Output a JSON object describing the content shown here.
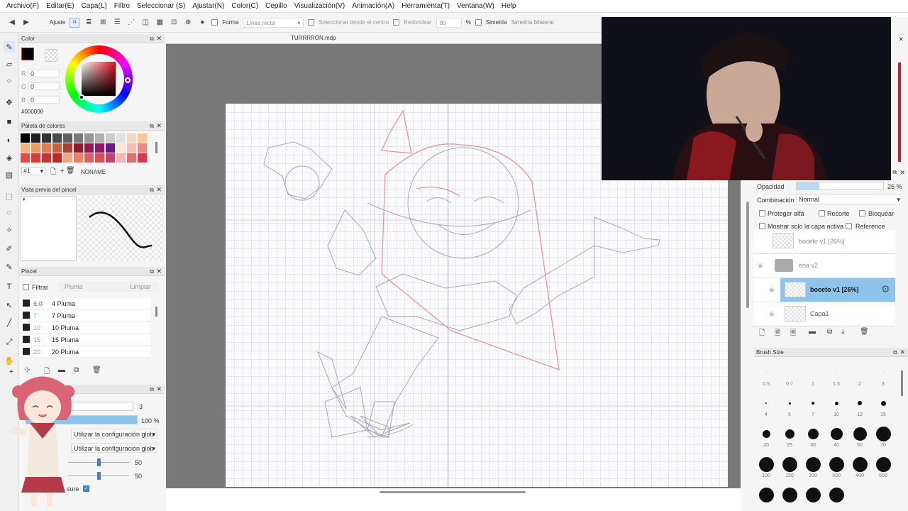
{
  "menu": [
    "Archivo(F)",
    "Editar(E)",
    "Capa(L)",
    "Filtro",
    "Seleccionar (S)",
    "Ajustar(N)",
    "Color(C)",
    "Cepillo",
    "Visualización(V)",
    "Animación(A)",
    "Herramienta(T)",
    "Ventana(W)",
    "Help"
  ],
  "toolbar": {
    "ajuste": "Ajuste",
    "forma": "Forma",
    "forma_value": "Línea recta",
    "select_center": "Seleccionar desde el centro",
    "redondear": "Redondear",
    "redondear_value": "80",
    "percent": "%",
    "simetria": "Simetría",
    "simetria_value": "Simetría bilateral"
  },
  "doc": {
    "filename": "TURRRRÓN.mdp"
  },
  "color_panel": {
    "title": "Color",
    "r_label": "R",
    "g_label": "G",
    "b_label": "B",
    "r": "0",
    "g": "0",
    "b": "0",
    "hex": "#000000",
    "foreground": "#000000"
  },
  "palette": {
    "title": "Paleta de colores",
    "index": "#1",
    "name": "NONAME",
    "colors": [
      "#000000",
      "#1f1f1f",
      "#333333",
      "#4a4a4a",
      "#606060",
      "#7a7a7a",
      "#959595",
      "#b0b0b0",
      "#cbcbcb",
      "#e0e0e0",
      "#f5d6b8",
      "#f7c79a",
      "#f4b07d",
      "#e99a6a",
      "#dd7f55",
      "#c86445",
      "#a94030",
      "#8e1c2a",
      "#9a1650",
      "#8a1a6a",
      "#6a1a80",
      "#f7e6d6",
      "#f3c0b0",
      "#e98a8a",
      "#e24c4c",
      "#d83a3a",
      "#c93232",
      "#b82a2a",
      "#f0a48a",
      "#e8806a",
      "#e06060",
      "#d84c5c",
      "#c84070",
      "#f2b5b5",
      "#e27070",
      "#d83a50"
    ]
  },
  "brush_preview": {
    "title": "Vista previa del pincel"
  },
  "brush_panel": {
    "title": "Pincel",
    "filter": "Filtrar",
    "search_placeholder": "Pluma",
    "clear": "Limpiar",
    "brushes": [
      {
        "size": "6.0",
        "name": "4 Pluma"
      },
      {
        "size": "7",
        "name": "7 Pluma"
      },
      {
        "size": "10",
        "name": "10 Pluma"
      },
      {
        "size": "15",
        "name": "15 Pluma"
      },
      {
        "size": "20",
        "name": "20 Pluma"
      }
    ]
  },
  "brush_settings": {
    "title_suffix": "s",
    "size_value": "3",
    "opacity_value": "100 %",
    "global1": "Utilizar la configuración glob",
    "global2": "Utilizar la configuración glob",
    "slider1": "50",
    "slider2": "50",
    "pressure": "sure",
    "opacity_fraction": 1.0,
    "slider1_fraction": 0.5,
    "slider2_fraction": 0.5
  },
  "layer_panel": {
    "opacity_label": "Opacidad",
    "opacity_value": "26 %",
    "opacity_fraction": 0.26,
    "blend_label": "Combinación",
    "blend_value": "Normal",
    "protect_alpha": "Proteger alfa",
    "clipping": "Recorte",
    "lock": "Bloquear",
    "show_active_only": "Mostrar solo la capa activa",
    "reference": "Reference",
    "layers": [
      {
        "name": "boceto v1 [26%]"
      },
      {
        "name": "ena v2"
      },
      {
        "name": "boceto v1 [26%]"
      },
      {
        "name": "Capa1"
      }
    ]
  },
  "brush_size": {
    "title": "Brush Size",
    "sizes": [
      "0.5",
      "0.7",
      "1",
      "1.5",
      "2",
      "3",
      "4",
      "5",
      "7",
      "10",
      "12",
      "15",
      "20",
      "25",
      "30",
      "40",
      "50",
      "70",
      "100",
      "150",
      "200",
      "300",
      "400",
      "500"
    ]
  }
}
